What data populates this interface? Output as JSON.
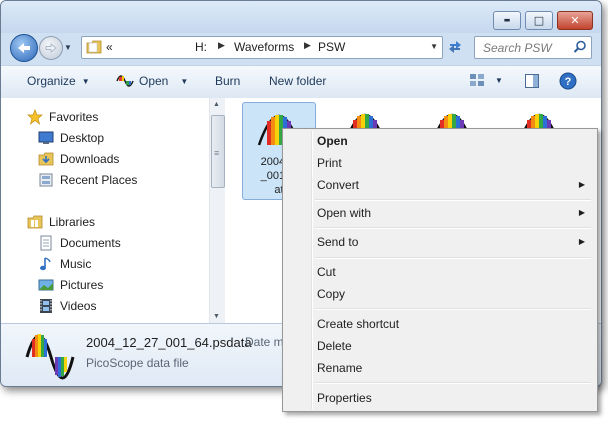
{
  "window": {
    "controls": {
      "minimize": "▬",
      "maximize": "□",
      "close": "✕"
    }
  },
  "address": {
    "overflow": "«",
    "segments": [
      "H:",
      "Waveforms",
      "PSW"
    ]
  },
  "search": {
    "placeholder": "Search PSW"
  },
  "toolbar": {
    "organize": "Organize",
    "open": "Open",
    "burn": "Burn",
    "new_folder": "New folder"
  },
  "nav": {
    "favorites": {
      "label": "Favorites",
      "items": [
        "Desktop",
        "Downloads",
        "Recent Places"
      ]
    },
    "libraries": {
      "label": "Libraries",
      "items": [
        "Documents",
        "Music",
        "Pictures",
        "Videos"
      ]
    }
  },
  "files": {
    "selected_caption": [
      "2004_1",
      "_001_6",
      "at"
    ]
  },
  "details": {
    "filename": "2004_12_27_001_64.psdata",
    "type": "PicoScope data file",
    "date_label": "Date m"
  },
  "context_menu": {
    "items": [
      {
        "label": "Open",
        "default": true
      },
      {
        "label": "Print"
      },
      {
        "label": "Convert",
        "submenu": true
      },
      {
        "label": "Open with",
        "submenu": true
      },
      {
        "label": "Send to",
        "submenu": true
      },
      {
        "label": "Cut"
      },
      {
        "label": "Copy"
      },
      {
        "label": "Create shortcut"
      },
      {
        "label": "Delete"
      },
      {
        "label": "Rename"
      },
      {
        "label": "Properties"
      }
    ]
  },
  "icons": {
    "back": "arrow-left-icon",
    "forward": "arrow-right-icon",
    "folder": "folder-icon",
    "refresh": "refresh-icon",
    "search": "magnifier-icon",
    "views": "views-icon",
    "preview": "preview-pane-icon",
    "help": "help-icon",
    "file": "psdata-waveform-icon"
  },
  "colors": {
    "selection": "#cce4f7",
    "menu_bg": "#f0f0f0",
    "accent": "#1e395b"
  }
}
